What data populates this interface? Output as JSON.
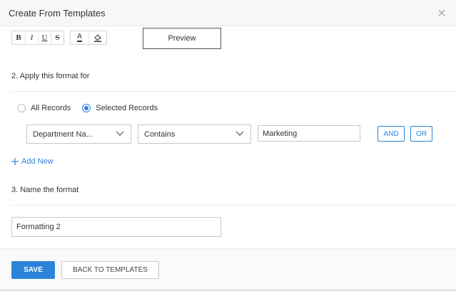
{
  "dialog": {
    "title": "Create From Templates"
  },
  "toolbar": {
    "bold_label": "B",
    "italic_label": "I",
    "underline_label": "U",
    "strike_label": "S",
    "font_color_label": "A",
    "fill_icon": "paint-bucket-icon"
  },
  "preview": {
    "label": "Preview"
  },
  "section2": {
    "label": "2. Apply this format for",
    "radio_all": "All Records",
    "radio_selected": "Selected Records",
    "selected_option": "Selected Records"
  },
  "condition": {
    "field": "Department Na...",
    "operator": "Contains",
    "value": "Marketing",
    "and_label": "AND",
    "or_label": "OR"
  },
  "add_new": {
    "label": "Add New"
  },
  "section3": {
    "label": "3. Name the format",
    "name_value": "Formatting 2"
  },
  "footer": {
    "save_label": "SAVE",
    "back_label": "BACK TO TEMPLATES"
  },
  "colors": {
    "accent": "#2c84d9"
  }
}
